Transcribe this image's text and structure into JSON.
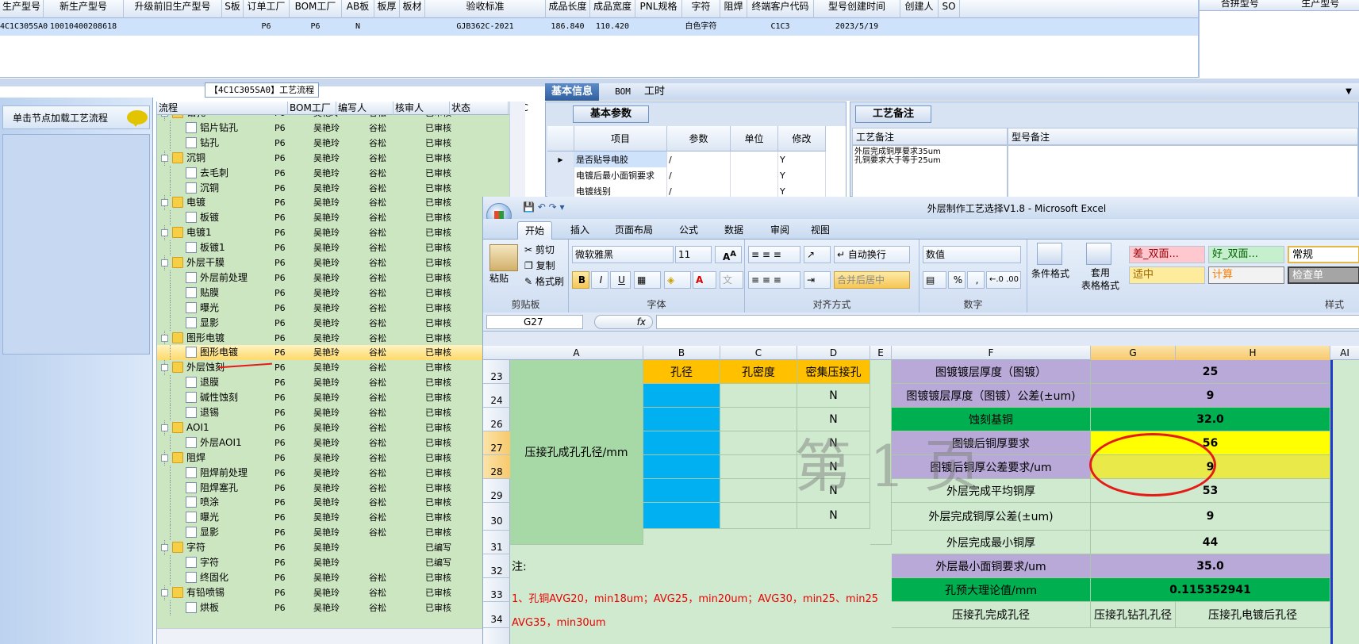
{
  "top_grid": {
    "headers": [
      "生产型号",
      "新生产型号",
      "升级前旧生产型号",
      "S板",
      "订单工厂",
      "BOM工厂",
      "AB板",
      "板厚",
      "板材",
      "验收标准",
      "成品长度",
      "成品宽度",
      "PNL规格",
      "字符",
      "阻焊",
      "终端客户代码",
      "型号创建时间",
      "创建人",
      "SO"
    ],
    "row": [
      "4C1C305SA0",
      "10010400208618",
      "",
      "",
      "P6",
      "P6",
      "N",
      "",
      "",
      "GJB362C-2021",
      "186.840",
      "110.420",
      "",
      "白色字符",
      "",
      "C1C3",
      "2023/5/19",
      "",
      ""
    ]
  },
  "right_panel": {
    "headers": [
      "合拼型号",
      "生产型号"
    ]
  },
  "process_title": "【4C1C305SA0】工艺流程",
  "left_panel": {
    "load_button": "单击节点加载工艺流程"
  },
  "tree": {
    "headers": [
      "流程",
      "BOM工厂",
      "编写人",
      "核审人",
      "状态",
      "PPC"
    ],
    "rows": [
      {
        "level": 0,
        "type": "folder",
        "label": "钻孔",
        "bom": "P6",
        "writer": "吴艳玲",
        "reviewer": "谷松",
        "status": "已审核"
      },
      {
        "level": 1,
        "type": "doc",
        "label": "铝片钻孔",
        "bom": "P6",
        "writer": "吴艳玲",
        "reviewer": "谷松",
        "status": "已审核"
      },
      {
        "level": 1,
        "type": "doc",
        "label": "钻孔",
        "bom": "P6",
        "writer": "吴艳玲",
        "reviewer": "谷松",
        "status": "已审核"
      },
      {
        "level": 0,
        "type": "folder",
        "label": "沉铜",
        "bom": "P6",
        "writer": "吴艳玲",
        "reviewer": "谷松",
        "status": "已审核"
      },
      {
        "level": 1,
        "type": "doc",
        "label": "去毛刺",
        "bom": "P6",
        "writer": "吴艳玲",
        "reviewer": "谷松",
        "status": "已审核"
      },
      {
        "level": 1,
        "type": "doc",
        "label": "沉铜",
        "bom": "P6",
        "writer": "吴艳玲",
        "reviewer": "谷松",
        "status": "已审核"
      },
      {
        "level": 0,
        "type": "folder",
        "label": "电镀",
        "bom": "P6",
        "writer": "吴艳玲",
        "reviewer": "谷松",
        "status": "已审核"
      },
      {
        "level": 1,
        "type": "doc",
        "label": "板镀",
        "bom": "P6",
        "writer": "吴艳玲",
        "reviewer": "谷松",
        "status": "已审核"
      },
      {
        "level": 0,
        "type": "folder",
        "label": "电镀1",
        "bom": "P6",
        "writer": "吴艳玲",
        "reviewer": "谷松",
        "status": "已审核"
      },
      {
        "level": 1,
        "type": "doc",
        "label": "板镀1",
        "bom": "P6",
        "writer": "吴艳玲",
        "reviewer": "谷松",
        "status": "已审核"
      },
      {
        "level": 0,
        "type": "folder",
        "label": "外层干膜",
        "bom": "P6",
        "writer": "吴艳玲",
        "reviewer": "谷松",
        "status": "已审核"
      },
      {
        "level": 1,
        "type": "doc",
        "label": "外层前处理",
        "bom": "P6",
        "writer": "吴艳玲",
        "reviewer": "谷松",
        "status": "已审核"
      },
      {
        "level": 1,
        "type": "doc",
        "label": "贴膜",
        "bom": "P6",
        "writer": "吴艳玲",
        "reviewer": "谷松",
        "status": "已审核"
      },
      {
        "level": 1,
        "type": "doc",
        "label": "曝光",
        "bom": "P6",
        "writer": "吴艳玲",
        "reviewer": "谷松",
        "status": "已审核"
      },
      {
        "level": 1,
        "type": "doc",
        "label": "显影",
        "bom": "P6",
        "writer": "吴艳玲",
        "reviewer": "谷松",
        "status": "已审核"
      },
      {
        "level": 0,
        "type": "folder",
        "label": "图形电镀",
        "bom": "P6",
        "writer": "吴艳玲",
        "reviewer": "谷松",
        "status": "已审核"
      },
      {
        "level": 1,
        "type": "doc",
        "label": "图形电镀",
        "bom": "P6",
        "writer": "吴艳玲",
        "reviewer": "谷松",
        "status": "已审核",
        "selected": true
      },
      {
        "level": 0,
        "type": "folder",
        "label": "外层蚀刻",
        "bom": "P6",
        "writer": "吴艳玲",
        "reviewer": "谷松",
        "status": "已审核"
      },
      {
        "level": 1,
        "type": "doc",
        "label": "退膜",
        "bom": "P6",
        "writer": "吴艳玲",
        "reviewer": "谷松",
        "status": "已审核"
      },
      {
        "level": 1,
        "type": "doc",
        "label": "碱性蚀刻",
        "bom": "P6",
        "writer": "吴艳玲",
        "reviewer": "谷松",
        "status": "已审核"
      },
      {
        "level": 1,
        "type": "doc",
        "label": "退锡",
        "bom": "P6",
        "writer": "吴艳玲",
        "reviewer": "谷松",
        "status": "已审核"
      },
      {
        "level": 0,
        "type": "folder",
        "label": "AOI1",
        "bom": "P6",
        "writer": "吴艳玲",
        "reviewer": "谷松",
        "status": "已审核"
      },
      {
        "level": 1,
        "type": "doc",
        "label": "外层AOI1",
        "bom": "P6",
        "writer": "吴艳玲",
        "reviewer": "谷松",
        "status": "已审核"
      },
      {
        "level": 0,
        "type": "folder",
        "label": "阻焊",
        "bom": "P6",
        "writer": "吴艳玲",
        "reviewer": "谷松",
        "status": "已审核"
      },
      {
        "level": 1,
        "type": "doc",
        "label": "阻焊前处理",
        "bom": "P6",
        "writer": "吴艳玲",
        "reviewer": "谷松",
        "status": "已审核"
      },
      {
        "level": 1,
        "type": "doc",
        "label": "阻焊塞孔",
        "bom": "P6",
        "writer": "吴艳玲",
        "reviewer": "谷松",
        "status": "已审核"
      },
      {
        "level": 1,
        "type": "doc",
        "label": "喷涂",
        "bom": "P6",
        "writer": "吴艳玲",
        "reviewer": "谷松",
        "status": "已审核"
      },
      {
        "level": 1,
        "type": "doc",
        "label": "曝光",
        "bom": "P6",
        "writer": "吴艳玲",
        "reviewer": "谷松",
        "status": "已审核"
      },
      {
        "level": 1,
        "type": "doc",
        "label": "显影",
        "bom": "P6",
        "writer": "吴艳玲",
        "reviewer": "谷松",
        "status": "已审核"
      },
      {
        "level": 0,
        "type": "folder",
        "label": "字符",
        "bom": "P6",
        "writer": "吴艳玲",
        "reviewer": "",
        "status": "已编写"
      },
      {
        "level": 1,
        "type": "doc",
        "label": "字符",
        "bom": "P6",
        "writer": "吴艳玲",
        "reviewer": "",
        "status": "已编写"
      },
      {
        "level": 1,
        "type": "doc",
        "label": "终固化",
        "bom": "P6",
        "writer": "吴艳玲",
        "reviewer": "谷松",
        "status": "已审核"
      },
      {
        "level": 0,
        "type": "folder",
        "label": "有铅喷锡",
        "bom": "P6",
        "writer": "吴艳玲",
        "reviewer": "谷松",
        "status": "已审核"
      },
      {
        "level": 1,
        "type": "doc",
        "label": "烘板",
        "bom": "P6",
        "writer": "吴艳玲",
        "reviewer": "谷松",
        "status": "已审核"
      }
    ]
  },
  "info_tabs": [
    "基本信息",
    "BOM",
    "工时"
  ],
  "params": {
    "title": "基本参数",
    "headers": [
      "项目",
      "参数",
      "单位",
      "修改"
    ],
    "rows": [
      [
        "是否贴导电胶",
        "/",
        "",
        "Y"
      ],
      [
        "电镀后最小面铜要求",
        "/",
        "",
        "Y"
      ],
      [
        "电镀线别",
        "/",
        "",
        "Y"
      ]
    ]
  },
  "remarks": {
    "title": "工艺备注",
    "col1_header": "工艺备注",
    "col2_header": "型号备注",
    "col1_text_1": "外层完成铜厚要求35um",
    "col1_text_2": "孔铜要求大于等于25um"
  },
  "excel": {
    "title": "外层制作工艺选择V1.8 - Microsoft Excel",
    "menu": [
      "开始",
      "插入",
      "页面布局",
      "公式",
      "数据",
      "审阅",
      "视图"
    ],
    "ribbon": {
      "clipboard": {
        "label": "剪贴板",
        "paste": "粘贴",
        "cut": "剪切",
        "copy": "复制",
        "format_painter": "格式刷"
      },
      "font": {
        "label": "字体",
        "name": "微软雅黑",
        "size": "11",
        "bold": "B",
        "italic": "I",
        "underline": "U"
      },
      "alignment": {
        "label": "对齐方式",
        "wrap": "自动换行",
        "merge": "合并后居中"
      },
      "number": {
        "label": "数字",
        "format": "数值",
        "percent": "%",
        "comma": ","
      },
      "styles": {
        "label": "样式",
        "cond": "条件格式",
        "table1": "套用",
        "table2": "表格格式",
        "bad": "差_双面...",
        "good": "好_双面...",
        "normal": "常规",
        "neutral": "适中",
        "calc": "计算",
        "check": "检查单"
      }
    },
    "name_box": "G27",
    "fx": "fx",
    "columns": [
      "A",
      "B",
      "C",
      "D",
      "E",
      "F",
      "G",
      "H",
      "AI"
    ],
    "rows": [
      "23",
      "24",
      "26",
      "27",
      "28",
      "29",
      "30",
      "31",
      "32",
      "33",
      "34"
    ],
    "cells": {
      "a_merge": "压接孔成孔孔径/mm",
      "b_hdr": "孔径",
      "c_hdr": "孔密度",
      "d_hdr": "密集压接孔",
      "d_vals": [
        "N",
        "N",
        "N",
        "N",
        "N",
        "N"
      ],
      "f": [
        "图镀镀层厚度（图镀）",
        "图镀镀层厚度（图镀）公差(±um)",
        "蚀刻基铜",
        "图镀后铜厚要求",
        "图镀后铜厚公差要求/um",
        "外层完成平均铜厚",
        "外层完成铜厚公差(±um)",
        "外层完成最小铜厚",
        "外层最小面铜要求/um",
        "孔预大理论值/mm",
        "压接孔完成孔径"
      ],
      "g": [
        "25",
        "9",
        "32.0",
        "56",
        "9",
        "53",
        "9",
        "44",
        "35.0",
        "0.115352941",
        "压接孔钻孔孔径"
      ],
      "h34": "压接孔电镀后孔径",
      "note_label": "注:",
      "note1": "1、孔铜AVG20，min18um；AVG25，min20um；AVG30，min25、min25",
      "note2": "AVG35，min30um"
    },
    "watermark": "第 1 页"
  },
  "colors": {
    "tree_bg": "#cde6c2",
    "selected_row": "#ffd96a",
    "excel_yellow": "#ffff00",
    "excel_green": "#00b050",
    "excel_lavender": "#b9a9d8",
    "annotation_red": "#e41b17"
  }
}
